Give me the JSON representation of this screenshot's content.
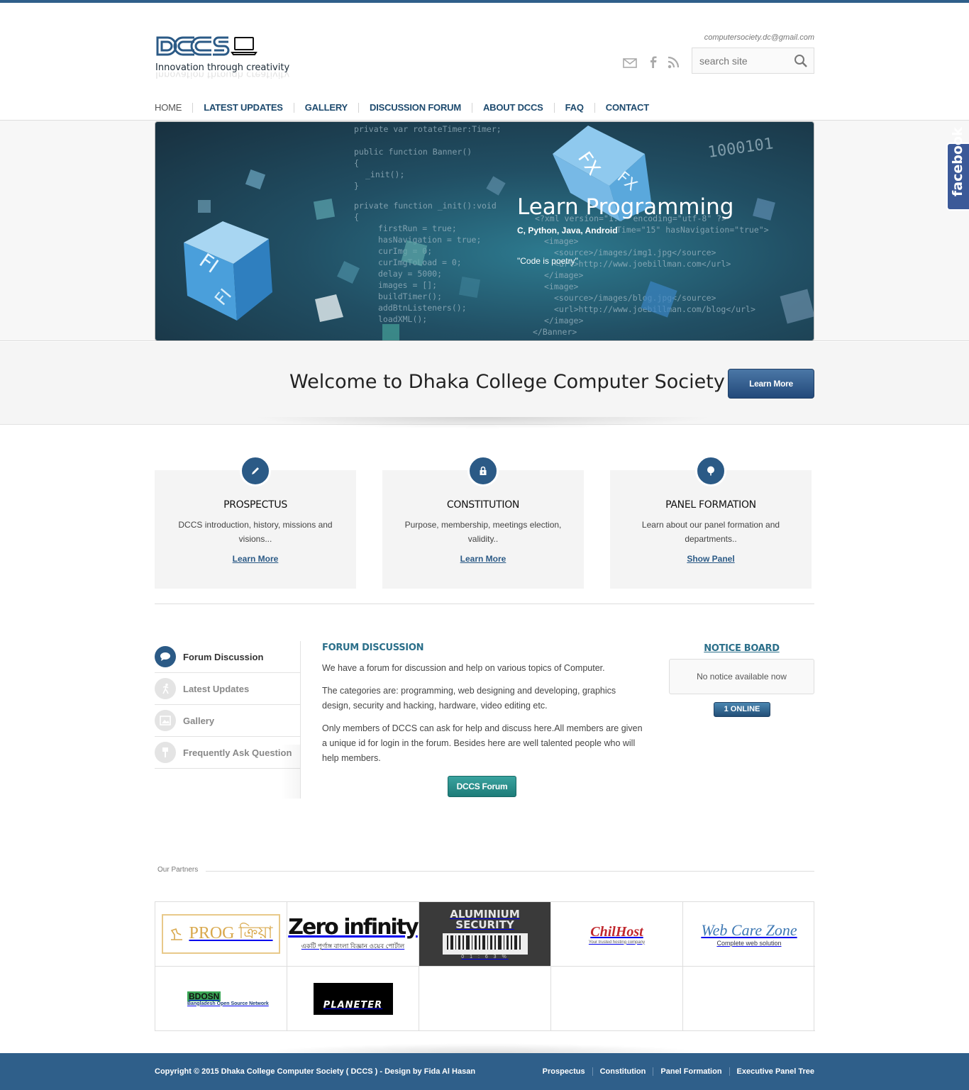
{
  "header": {
    "logo_text": "DCCS",
    "tagline": "Innovation through creativity",
    "email": "computersociety.dc@gmail.com",
    "search_placeholder": "search site"
  },
  "nav": [
    {
      "label": "HOME"
    },
    {
      "label": "LATEST UPDATES"
    },
    {
      "label": "GALLERY"
    },
    {
      "label": "DISCUSSION FORUM"
    },
    {
      "label": "ABOUT DCCS"
    },
    {
      "label": "FAQ"
    },
    {
      "label": "CONTACT"
    }
  ],
  "banner": {
    "title": "Learn Programming",
    "subtitle": "C, Python, Java, Android",
    "quote": "\"Code is poetry\""
  },
  "facebook_tab": "facebook",
  "welcome": {
    "text": "Welcome to Dhaka College Computer Society",
    "button": "Learn More"
  },
  "features": [
    {
      "icon": "pencil-icon",
      "title": "PROSPECTUS",
      "text": "DCCS introduction, history, missions and visions...",
      "link": "Learn More"
    },
    {
      "icon": "lock-icon",
      "title": "CONSTITUTION",
      "text": "Purpose, membership, meetings election, validity..",
      "link": "Learn More"
    },
    {
      "icon": "tree-icon",
      "title": "PANEL FORMATION",
      "text": "Learn about our panel formation and departments..",
      "link": "Show Panel"
    }
  ],
  "tabs": [
    {
      "label": "Forum Discussion",
      "icon": "chat-icon",
      "active": true
    },
    {
      "label": "Latest Updates",
      "icon": "runner-icon",
      "active": false
    },
    {
      "label": "Gallery",
      "icon": "picture-icon",
      "active": false
    },
    {
      "label": "Frequently Ask Question",
      "icon": "pin-icon",
      "active": false
    }
  ],
  "forum": {
    "title": "FORUM DISCUSSION",
    "paragraphs": [
      "We have a forum for discussion and help on various topics of Computer.",
      "The categories are: programming, web designing and developing, graphics design, security and hacking, hardware, video editing etc.",
      "Only members of DCCS can ask for help and discuss here.All members are given a unique id for login in the forum. Besides here are well talented people who will help members."
    ],
    "button": "DCCS Forum"
  },
  "notice_board": {
    "title": "NOTICE BOARD",
    "message": "No notice available now",
    "online": "1 ONLINE"
  },
  "partners": {
    "label": "Our Partners",
    "logos": [
      {
        "name": "prog-kria-logo",
        "text": "PROG ক্রিয়া"
      },
      {
        "name": "zero-infinity-logo",
        "text": "Zero infinity",
        "subtext": "একটি পূর্ণাঙ্গ বাংলা বিজ্ঞান ওয়েব পোর্টাল"
      },
      {
        "name": "aluminium-security-logo",
        "text": "ALUMINIUM SECURITY",
        "subtext": "0 1 : 6 3 %"
      },
      {
        "name": "chillhost-logo",
        "text": "ChilHost",
        "subtext": "Your trusted hosting company"
      },
      {
        "name": "web-care-zone-logo",
        "text": "Web Care Zone",
        "subtext": "Complete web solution"
      },
      {
        "name": "bdosn-logo",
        "text": "BDOSN",
        "subtext": "Bangladesh Open Source Network"
      },
      {
        "name": "planeter-logo",
        "text": "PLANETER"
      }
    ]
  },
  "footer": {
    "copyright": "Copyright © 2015 Dhaka College Computer Society ( DCCS ) - Design by Fida Al Hasan",
    "links": [
      "Prospectus",
      "Constitution",
      "Panel Formation",
      "Executive Panel Tree"
    ]
  },
  "colors": {
    "brand": "#2f5f8a",
    "nav_text": "#1d4a6e",
    "accent_teal": "#2b6f8a",
    "forum_button": "#1d7c79"
  }
}
